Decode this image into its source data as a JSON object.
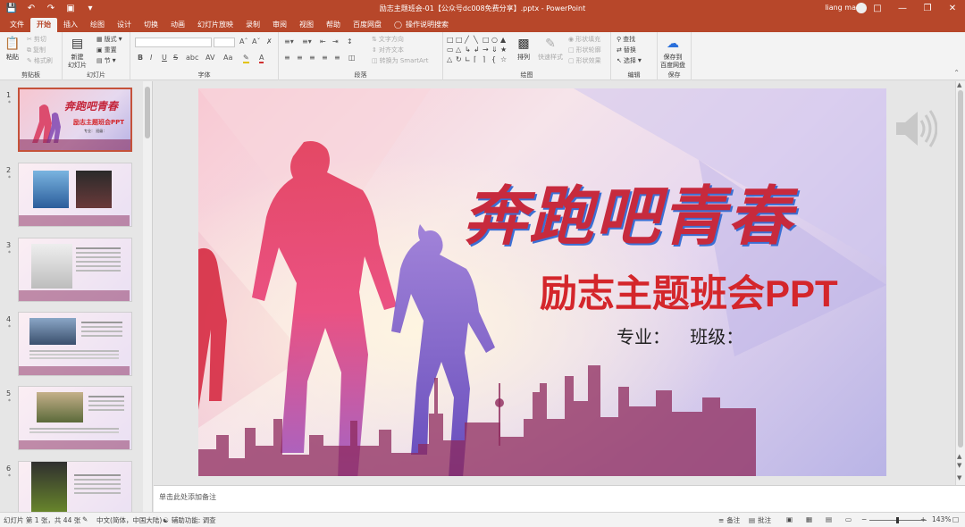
{
  "titlebar": {
    "doc_title": "励志主题班会-01【公众号dc008免费分享】.pptx  -  PowerPoint",
    "user": "liang ma",
    "qat_icons": [
      "save-icon",
      "undo-icon",
      "redo-icon",
      "present-icon",
      "customize-icon"
    ],
    "window_controls": [
      "ribbon-display-icon",
      "minimize-icon",
      "restore-icon",
      "close-icon"
    ]
  },
  "tabs": [
    "文件",
    "开始",
    "插入",
    "绘图",
    "设计",
    "切换",
    "动画",
    "幻灯片放映",
    "录制",
    "审阅",
    "视图",
    "帮助",
    "百度网盘"
  ],
  "active_tab": "开始",
  "tell_me": "操作说明搜索",
  "ribbon": {
    "clipboard": {
      "label": "剪贴板",
      "paste": "粘贴",
      "cut": "剪切",
      "copy": "复制",
      "format_painter": "格式刷"
    },
    "slides": {
      "label": "幻灯片",
      "new_slide": "新建\n幻灯片",
      "layout": "版式",
      "reset": "重置",
      "section": "节"
    },
    "font": {
      "label": "字体",
      "bold": "B",
      "italic": "I",
      "underline": "U",
      "strike": "S",
      "shadow": "abc",
      "spacing": "AV",
      "case": "Aa",
      "color": "A"
    },
    "paragraph": {
      "label": "段落",
      "text_direction": "文字方向",
      "align_text": "对齐文本",
      "smartart": "转换为 SmartArt"
    },
    "drawing": {
      "label": "绘图",
      "arrange": "排列",
      "quick_styles": "快速样式",
      "fill": "形状填充",
      "outline": "形状轮廓",
      "effects": "形状效果"
    },
    "editing": {
      "label": "编辑",
      "find": "查找",
      "replace": "替换",
      "select": "选择"
    },
    "save": {
      "label": "保存",
      "save_baidu": "保存到\n百度网盘"
    }
  },
  "slides": [
    {
      "num": "1",
      "star": "*"
    },
    {
      "num": "2",
      "star": "*"
    },
    {
      "num": "3",
      "star": "*"
    },
    {
      "num": "4",
      "star": "*"
    },
    {
      "num": "5",
      "star": "*"
    },
    {
      "num": "6",
      "star": "*"
    }
  ],
  "current_slide": {
    "title": "奔跑吧青春",
    "subtitle": "励志主题班会PPT",
    "info": "专业：    班级："
  },
  "thumb_texts": {
    "t1_title": "奔跑吧青春",
    "t1_sub": "励志主题班会PPT",
    "t1_info": "专业：  班级："
  },
  "notes_placeholder": "单击此处添加备注",
  "status": {
    "slide_info": "幻灯片 第 1 张，共 44 张",
    "language": "中文(简体，中国大陆)",
    "accessibility": "辅助功能: 调查",
    "notes": "备注",
    "comments": "批注",
    "zoom": "143%"
  },
  "colors": {
    "accent": "#b7472a",
    "title_red": "#d4262b"
  }
}
